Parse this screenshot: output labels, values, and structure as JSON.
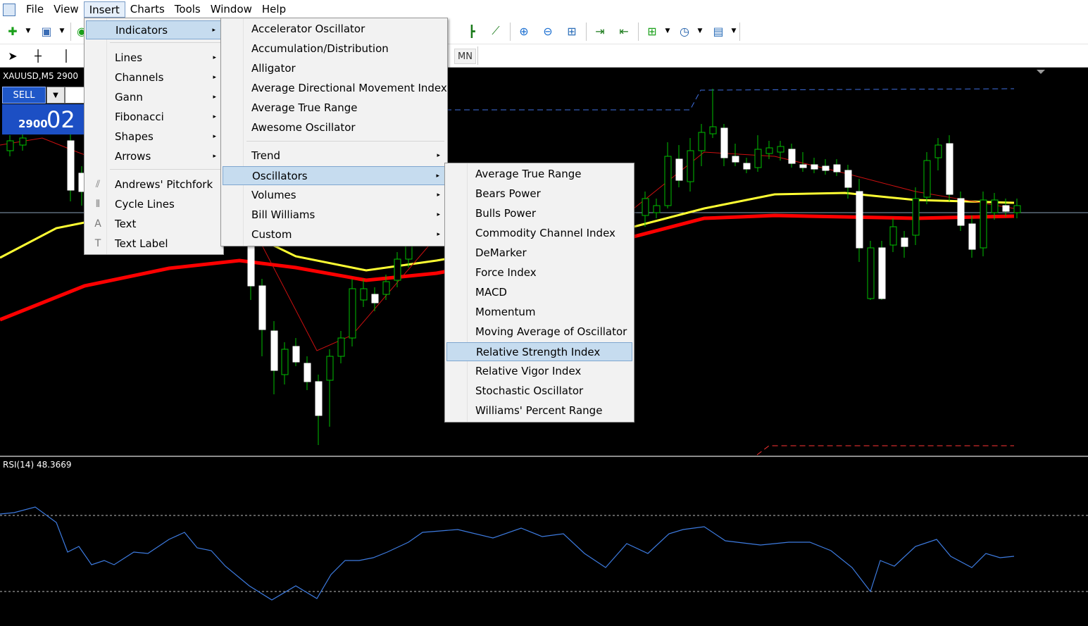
{
  "menubar": {
    "items": [
      "File",
      "View",
      "Insert",
      "Charts",
      "Tools",
      "Window",
      "Help"
    ],
    "active": "Insert"
  },
  "toolbar": {
    "timeframe_visible": "MN"
  },
  "chart": {
    "symbol_label": "XAUUSD,M5  2900",
    "sell_label": "SELL",
    "price_small": "2900",
    "price_big": "02",
    "rsi_label": "RSI(14) 48.3669",
    "colors": {
      "background": "#000000",
      "bull_candle": "#ffffff",
      "wick": "#00c000",
      "ma_slow": "#ff0000",
      "ma_medium": "#ffff33",
      "ma_fast": "#cc1010",
      "rsi_line": "#3d7be0",
      "level_line": "#ff3333",
      "dashed_top": "#3f6fe0"
    }
  },
  "insert_menu": {
    "items": [
      {
        "label": "Indicators",
        "submenu": true,
        "selected": true
      },
      {
        "label": "Lines",
        "submenu": true
      },
      {
        "label": "Channels",
        "submenu": true
      },
      {
        "label": "Gann",
        "submenu": true
      },
      {
        "label": "Fibonacci",
        "submenu": true
      },
      {
        "label": "Shapes",
        "submenu": true
      },
      {
        "label": "Arrows",
        "submenu": true
      },
      {
        "label": "Andrews' Pitchfork",
        "icon": "pitchfork-icon"
      },
      {
        "label": "Cycle Lines",
        "icon": "cycle-lines-icon"
      },
      {
        "label": "Text",
        "icon": "text-icon"
      },
      {
        "label": "Text Label",
        "icon": "text-label-icon"
      }
    ]
  },
  "indicators_menu": {
    "items": [
      {
        "label": "Accelerator Oscillator"
      },
      {
        "label": "Accumulation/Distribution"
      },
      {
        "label": "Alligator"
      },
      {
        "label": "Average Directional Movement Index"
      },
      {
        "label": "Average True Range"
      },
      {
        "label": "Awesome Oscillator"
      },
      {
        "label": "Trend",
        "submenu": true
      },
      {
        "label": "Oscillators",
        "submenu": true,
        "selected": true
      },
      {
        "label": "Volumes",
        "submenu": true
      },
      {
        "label": "Bill Williams",
        "submenu": true
      },
      {
        "label": "Custom",
        "submenu": true
      }
    ]
  },
  "oscillators_menu": {
    "items": [
      {
        "label": "Average True Range"
      },
      {
        "label": "Bears Power"
      },
      {
        "label": "Bulls Power"
      },
      {
        "label": "Commodity Channel Index"
      },
      {
        "label": "DeMarker"
      },
      {
        "label": "Force Index"
      },
      {
        "label": "MACD"
      },
      {
        "label": "Momentum"
      },
      {
        "label": "Moving Average of Oscillator"
      },
      {
        "label": "Relative Strength Index",
        "selected": true
      },
      {
        "label": "Relative Vigor Index"
      },
      {
        "label": "Stochastic Oscillator"
      },
      {
        "label": "Williams' Percent Range"
      }
    ]
  },
  "icons": {
    "submenu_arrow": "▸",
    "pitchfork": "⫽",
    "cycle_lines": "⦀",
    "text": "A",
    "text_label": "T"
  }
}
